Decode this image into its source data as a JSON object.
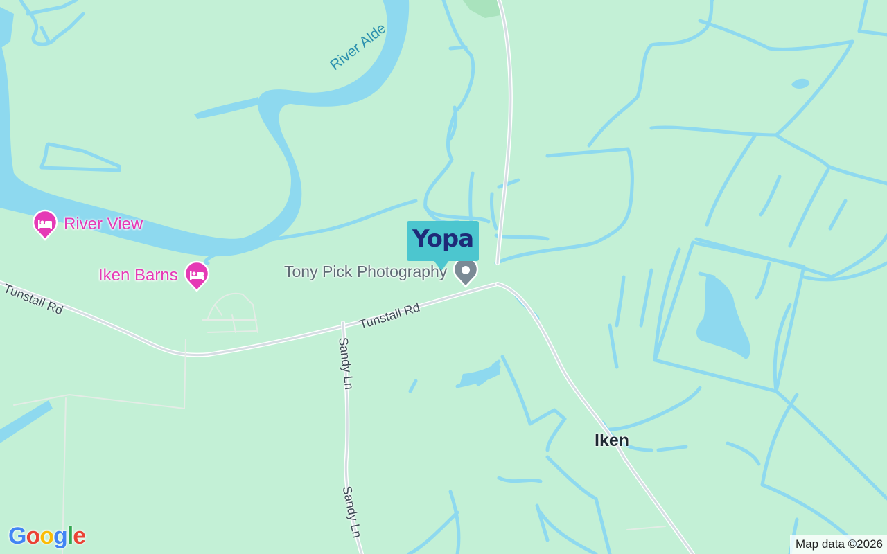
{
  "map": {
    "water_labels": {
      "river": "River Alde"
    },
    "roads": {
      "tunstall_west": "Tunstall Rd",
      "tunstall_east": "Tunstall Rd",
      "sandy_north": "Sandy Ln",
      "sandy_south": "Sandy Ln"
    },
    "places": {
      "village": "Iken"
    },
    "pois": [
      {
        "name": "River View",
        "category": "hotel-icon",
        "color": "#e53ab5"
      },
      {
        "name": "Iken Barns",
        "category": "hotel-icon",
        "color": "#e53ab5"
      },
      {
        "name": "Tony Pick Photography",
        "category": "location-pin-icon",
        "color": "#7b8a95"
      }
    ],
    "ad_marker": {
      "brand": "Yopa",
      "bg_color": "#4cc6cf",
      "text_color": "#1e2a78"
    },
    "logo": "Google",
    "attribution": "Map data ©2026"
  }
}
